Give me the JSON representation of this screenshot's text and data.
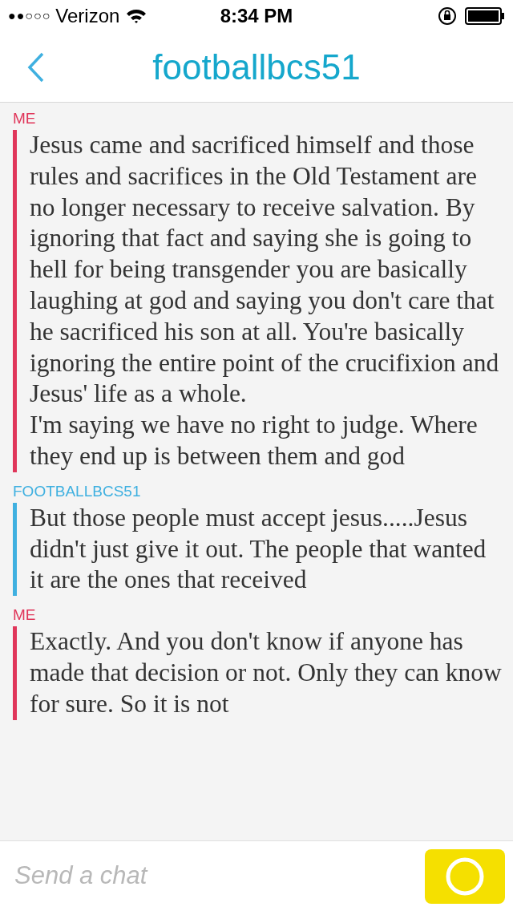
{
  "status_bar": {
    "signal": "●●○○○",
    "carrier": "Verizon",
    "time": "8:34 PM"
  },
  "header": {
    "title": "footballbcs51"
  },
  "messages": [
    {
      "sender": "ME",
      "kind": "me",
      "color": "#e0365a",
      "text": "Jesus came and sacrificed himself and those rules and sacrifices in the Old Testament are no longer necessary to receive salvation. By ignoring that fact and saying she is going to hell for being transgender you are basically laughing at god and saying you don't care that he sacrificed his son at all. You're basically ignoring the entire point of the crucifixion and Jesus' life as a whole.\nI'm saying we have no right to judge. Where they end up is between them and god"
    },
    {
      "sender": "FOOTBALLBCS51",
      "kind": "friend",
      "color": "#3fb0e0",
      "text": "But those people must accept jesus.....Jesus didn't just give it out. The people that wanted it are the ones that received"
    },
    {
      "sender": "ME",
      "kind": "me",
      "color": "#e0365a",
      "text": "Exactly. And you don't know if anyone has made that decision or not. Only they can know for sure. So it is not"
    }
  ],
  "composer": {
    "placeholder": "Send a chat"
  }
}
